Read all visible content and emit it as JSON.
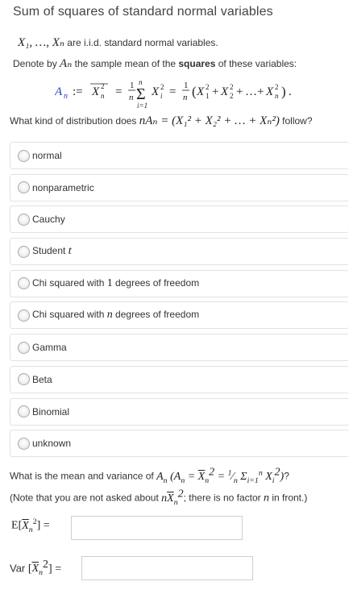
{
  "title": "Sum of squares of standard normal variables",
  "intro": {
    "line1_math": "X₁, …, Xₙ",
    "line1_text": " are i.i.d. standard normal variables.",
    "line2_pre": "Denote by ",
    "line2_math": "Aₙ",
    "line2_mid": " the sample mean of the ",
    "line2_bold": "squares",
    "line2_post": " of these variables:"
  },
  "question": {
    "pre": "What kind of distribution does ",
    "math": "nAₙ = (X₁² + X₂² + … + Xₙ²)",
    "post": " follow?"
  },
  "options": [
    {
      "pre": "normal",
      "math": "",
      "post": ""
    },
    {
      "pre": "nonparametric",
      "math": "",
      "post": ""
    },
    {
      "pre": "Cauchy",
      "math": "",
      "post": ""
    },
    {
      "pre": "Student ",
      "math": "t",
      "post": ""
    },
    {
      "pre": "Chi squared with ",
      "math": "1",
      "post": " degrees of freedom"
    },
    {
      "pre": "Chi squared with ",
      "math": "n",
      "post": " degrees of freedom"
    },
    {
      "pre": "Gamma",
      "math": "",
      "post": ""
    },
    {
      "pre": "Beta",
      "math": "",
      "post": ""
    },
    {
      "pre": "Binomial",
      "math": "",
      "post": ""
    },
    {
      "pre": "unknown",
      "math": "",
      "post": ""
    }
  ],
  "question2": {
    "pre": "What is the mean and variance of ",
    "post": "?"
  },
  "note": {
    "pre": "(Note that you are not asked about ",
    "mid": "; there is no factor ",
    "math_n": "n",
    "post": " in front.)"
  },
  "mean_field": {
    "label_math": "E",
    "value": "",
    "placeholder": ""
  },
  "var_field": {
    "label_text": "Var ",
    "value": "",
    "placeholder": ""
  },
  "colors": {
    "accent_math": "#1e3fc8",
    "border": "#e2e2e2"
  }
}
